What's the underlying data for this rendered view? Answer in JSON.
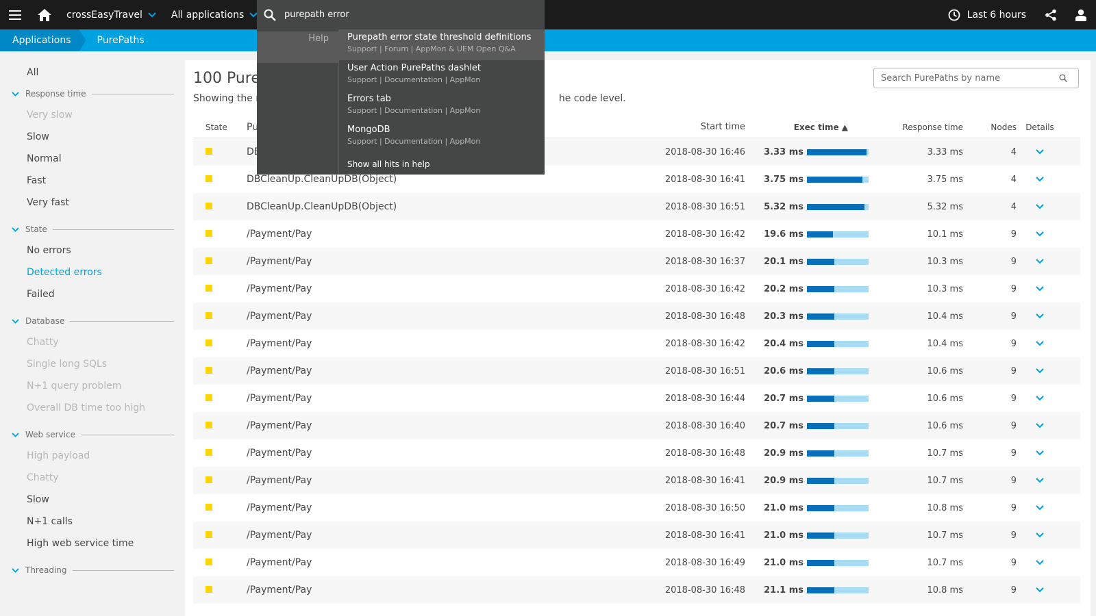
{
  "topbar": {
    "app_name": "crossEasyTravel",
    "all_apps_label": "All applications",
    "search_value": "purepath error",
    "timeframe": "Last 6 hours"
  },
  "breadcrumb": {
    "items": [
      "Applications",
      "PurePaths"
    ]
  },
  "sidebar": {
    "all": "All",
    "groups": [
      {
        "title": "Response time",
        "items": [
          {
            "label": "Very slow",
            "state": "muted"
          },
          {
            "label": "Slow",
            "state": "normal"
          },
          {
            "label": "Normal",
            "state": "normal"
          },
          {
            "label": "Fast",
            "state": "normal"
          },
          {
            "label": "Very fast",
            "state": "normal"
          }
        ]
      },
      {
        "title": "State",
        "items": [
          {
            "label": "No errors",
            "state": "normal"
          },
          {
            "label": "Detected errors",
            "state": "active"
          },
          {
            "label": "Failed",
            "state": "normal"
          }
        ]
      },
      {
        "title": "Database",
        "items": [
          {
            "label": "Chatty",
            "state": "muted"
          },
          {
            "label": "Single long SQLs",
            "state": "muted"
          },
          {
            "label": "N+1 query problem",
            "state": "muted"
          },
          {
            "label": "Overall DB time too high",
            "state": "muted"
          }
        ]
      },
      {
        "title": "Web service",
        "items": [
          {
            "label": "High payload",
            "state": "muted"
          },
          {
            "label": "Chatty",
            "state": "muted"
          },
          {
            "label": "Slow",
            "state": "normal"
          },
          {
            "label": "N+1 calls",
            "state": "normal"
          },
          {
            "label": "High web service time",
            "state": "normal"
          }
        ]
      },
      {
        "title": "Threading",
        "items": []
      }
    ]
  },
  "main": {
    "title_visible": "100 PureP",
    "subtitle_left": "Showing the m",
    "subtitle_right": "he code level.",
    "search_placeholder": "Search PurePaths by name",
    "columns": {
      "state": "State",
      "name": "Pu",
      "start": "Start time",
      "exec": "Exec time ▲",
      "response": "Response time",
      "nodes": "Nodes",
      "details": "Details"
    },
    "rows": [
      {
        "name": "DE",
        "start": "2018-08-30 16:46",
        "exec": "3.33 ms",
        "exec_fraction": 0.97,
        "response": "3.33 ms",
        "nodes": "4"
      },
      {
        "name": "DBCleanUp.CleanUpDB(Object)",
        "start": "2018-08-30 16:41",
        "exec": "3.75 ms",
        "exec_fraction": 0.9,
        "response": "3.75 ms",
        "nodes": "4"
      },
      {
        "name": "DBCleanUp.CleanUpDB(Object)",
        "start": "2018-08-30 16:51",
        "exec": "5.32 ms",
        "exec_fraction": 0.93,
        "response": "5.32 ms",
        "nodes": "4"
      },
      {
        "name": "/Payment/Pay",
        "start": "2018-08-30 16:42",
        "exec": "19.6 ms",
        "exec_fraction": 0.42,
        "response": "10.1 ms",
        "nodes": "9"
      },
      {
        "name": "/Payment/Pay",
        "start": "2018-08-30 16:37",
        "exec": "20.1 ms",
        "exec_fraction": 0.44,
        "response": "10.3 ms",
        "nodes": "9"
      },
      {
        "name": "/Payment/Pay",
        "start": "2018-08-30 16:42",
        "exec": "20.2 ms",
        "exec_fraction": 0.44,
        "response": "10.3 ms",
        "nodes": "9"
      },
      {
        "name": "/Payment/Pay",
        "start": "2018-08-30 16:48",
        "exec": "20.3 ms",
        "exec_fraction": 0.44,
        "response": "10.4 ms",
        "nodes": "9"
      },
      {
        "name": "/Payment/Pay",
        "start": "2018-08-30 16:42",
        "exec": "20.4 ms",
        "exec_fraction": 0.44,
        "response": "10.4 ms",
        "nodes": "9"
      },
      {
        "name": "/Payment/Pay",
        "start": "2018-08-30 16:51",
        "exec": "20.6 ms",
        "exec_fraction": 0.44,
        "response": "10.6 ms",
        "nodes": "9"
      },
      {
        "name": "/Payment/Pay",
        "start": "2018-08-30 16:44",
        "exec": "20.7 ms",
        "exec_fraction": 0.44,
        "response": "10.6 ms",
        "nodes": "9"
      },
      {
        "name": "/Payment/Pay",
        "start": "2018-08-30 16:40",
        "exec": "20.7 ms",
        "exec_fraction": 0.44,
        "response": "10.6 ms",
        "nodes": "9"
      },
      {
        "name": "/Payment/Pay",
        "start": "2018-08-30 16:48",
        "exec": "20.9 ms",
        "exec_fraction": 0.44,
        "response": "10.7 ms",
        "nodes": "9"
      },
      {
        "name": "/Payment/Pay",
        "start": "2018-08-30 16:41",
        "exec": "20.9 ms",
        "exec_fraction": 0.44,
        "response": "10.7 ms",
        "nodes": "9"
      },
      {
        "name": "/Payment/Pay",
        "start": "2018-08-30 16:50",
        "exec": "21.0 ms",
        "exec_fraction": 0.44,
        "response": "10.8 ms",
        "nodes": "9"
      },
      {
        "name": "/Payment/Pay",
        "start": "2018-08-30 16:41",
        "exec": "21.0 ms",
        "exec_fraction": 0.44,
        "response": "10.7 ms",
        "nodes": "9"
      },
      {
        "name": "/Payment/Pay",
        "start": "2018-08-30 16:49",
        "exec": "21.0 ms",
        "exec_fraction": 0.44,
        "response": "10.7 ms",
        "nodes": "9"
      },
      {
        "name": "/Payment/Pay",
        "start": "2018-08-30 16:48",
        "exec": "21.1 ms",
        "exec_fraction": 0.44,
        "response": "10.8 ms",
        "nodes": "9"
      }
    ]
  },
  "dropdown": {
    "category": "Help",
    "results": [
      {
        "title": "Purepath error state threshold definitions",
        "meta": "Support | Forum | AppMon & UEM Open Q&A"
      },
      {
        "title": "User Action PurePaths dashlet",
        "meta": "Support | Documentation | AppMon"
      },
      {
        "title": "Errors tab",
        "meta": "Support | Documentation | AppMon"
      },
      {
        "title": "MongoDB",
        "meta": "Support | Documentation | AppMon"
      }
    ],
    "show_all": "Show all hits in help"
  },
  "colors": {
    "topbar_bg": "#1b1b1b",
    "accent": "#00a1e0",
    "state_warning": "#ffd400",
    "bar_fill": "#0b6eb8",
    "bar_track": "#a8dcf5"
  },
  "icons": {
    "menu": "hamburger-menu-icon",
    "home": "home-icon",
    "search": "search-icon",
    "clock": "clock-icon",
    "share": "share-icon",
    "user": "user-icon",
    "chevron": "chevron-down-icon"
  }
}
